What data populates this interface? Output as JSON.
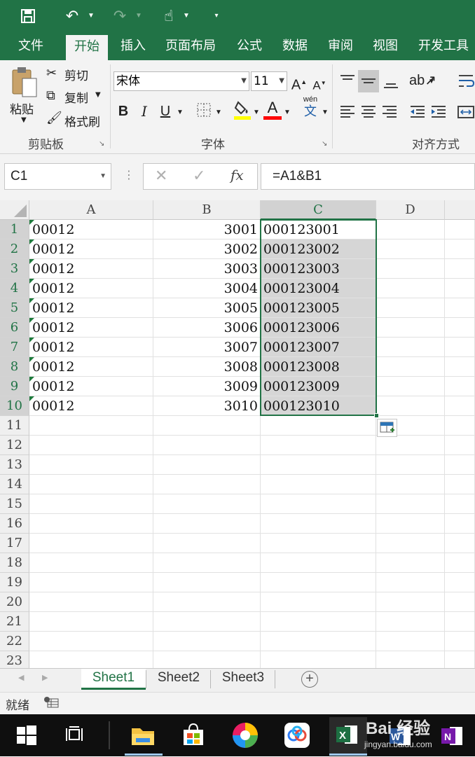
{
  "ribbon_tabs": [
    "文件",
    "开始",
    "插入",
    "页面布局",
    "公式",
    "数据",
    "审阅",
    "视图",
    "开发工具"
  ],
  "active_tab": "开始",
  "clipboard": {
    "paste": "粘贴",
    "cut": "剪切",
    "copy": "复制",
    "format_painter": "格式刷",
    "group": "剪贴板"
  },
  "font": {
    "name": "宋体",
    "size": "11",
    "group": "字体",
    "bold": "B",
    "italic": "I",
    "underline": "U",
    "grow": "A",
    "shrink": "A",
    "color_letter": "A",
    "phonetic": "wén",
    "phonetic_char": "文"
  },
  "alignment": {
    "group": "对齐方式"
  },
  "formula_bar": {
    "name_box": "C1",
    "fx": "fx",
    "formula": "=A1&B1"
  },
  "grid": {
    "columns": [
      "A",
      "B",
      "C",
      "D"
    ],
    "selected_column": "C",
    "row_numbers": [
      "1",
      "2",
      "3",
      "4",
      "5",
      "6",
      "7",
      "8",
      "9",
      "10",
      "11",
      "12",
      "13",
      "14",
      "15",
      "16",
      "17",
      "18",
      "19",
      "20",
      "21",
      "22",
      "23"
    ],
    "col_a": [
      "00012",
      "00012",
      "00012",
      "00012",
      "00012",
      "00012",
      "00012",
      "00012",
      "00012",
      "00012"
    ],
    "col_b": [
      "3001",
      "3002",
      "3003",
      "3004",
      "3005",
      "3006",
      "3007",
      "3008",
      "3009",
      "3010"
    ],
    "col_c": [
      "000123001",
      "000123002",
      "000123003",
      "000123004",
      "000123005",
      "000123006",
      "000123007",
      "000123008",
      "000123009",
      "000123010"
    ]
  },
  "sheets": [
    "Sheet1",
    "Sheet2",
    "Sheet3"
  ],
  "active_sheet": "Sheet1",
  "status": {
    "ready": "就绪"
  },
  "watermark": {
    "text": "Bai 经验",
    "url": "jingyan.baidu.com"
  },
  "colors": {
    "excel_green": "#217346",
    "selection_gray": "#d6d6d6"
  }
}
